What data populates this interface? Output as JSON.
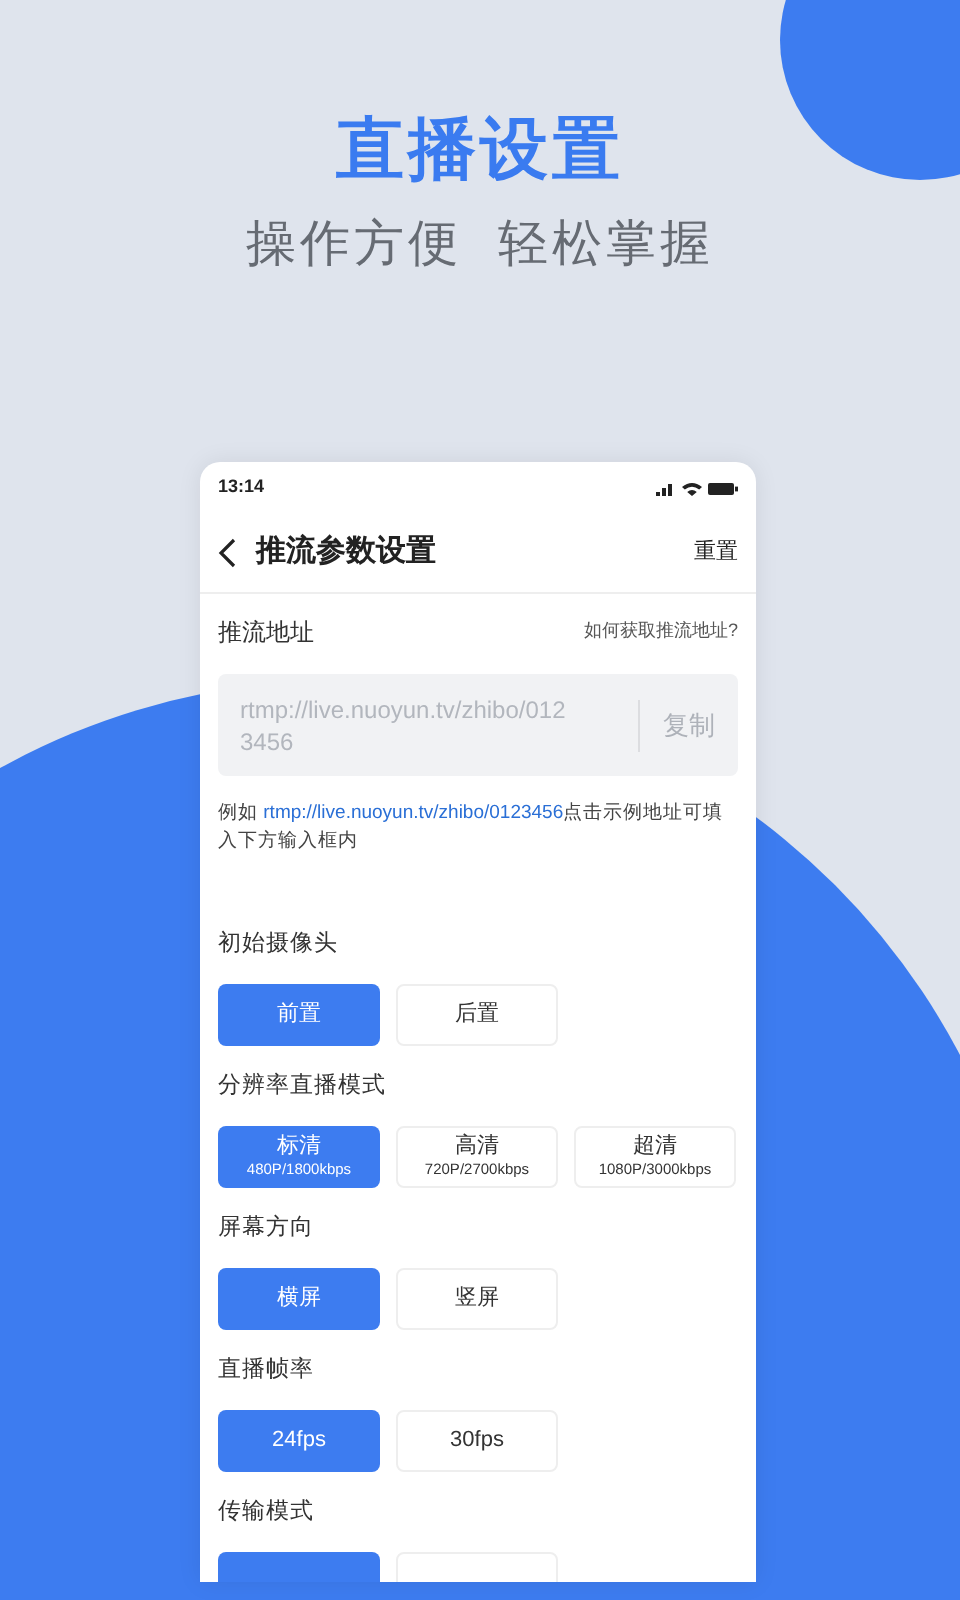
{
  "hero": {
    "title": "直播设置",
    "subtitle": [
      "操作方便",
      "轻松掌握"
    ]
  },
  "phone": {
    "status_bar": {
      "time": "13:14"
    },
    "header": {
      "title": "推流参数设置",
      "action": "重置"
    },
    "stream_url": {
      "label": "推流地址",
      "help_link": "如何获取推流地址?",
      "value": "rtmp://live.nuoyun.tv/zhibo/0123456",
      "copy_button": "复制"
    },
    "example": {
      "prefix": "例如",
      "link": "rtmp://live.nuoyun.tv/zhibo/0123456",
      "suffix": "点击示例地址可填入下方输入框内"
    },
    "sections": [
      {
        "label": "初始摄像头",
        "options": [
          {
            "label": "前置",
            "selected": true
          },
          {
            "label": "后置",
            "selected": false
          }
        ]
      },
      {
        "label": "分辨率直播模式",
        "options": [
          {
            "label": "标清",
            "sublabel": "480P/1800kbps",
            "selected": true
          },
          {
            "label": "高清",
            "sublabel": "720P/2700kbps",
            "selected": false
          },
          {
            "label": "超清",
            "sublabel": "1080P/3000kbps",
            "selected": false
          }
        ]
      },
      {
        "label": "屏幕方向",
        "options": [
          {
            "label": "横屏",
            "selected": true
          },
          {
            "label": "竖屏",
            "selected": false
          }
        ]
      },
      {
        "label": "直播帧率",
        "options": [
          {
            "label": "24fps",
            "selected": true
          },
          {
            "label": "30fps",
            "selected": false
          }
        ]
      },
      {
        "label": "传输模式",
        "options": [
          {
            "selected": true
          },
          {
            "selected": false
          }
        ]
      }
    ]
  }
}
